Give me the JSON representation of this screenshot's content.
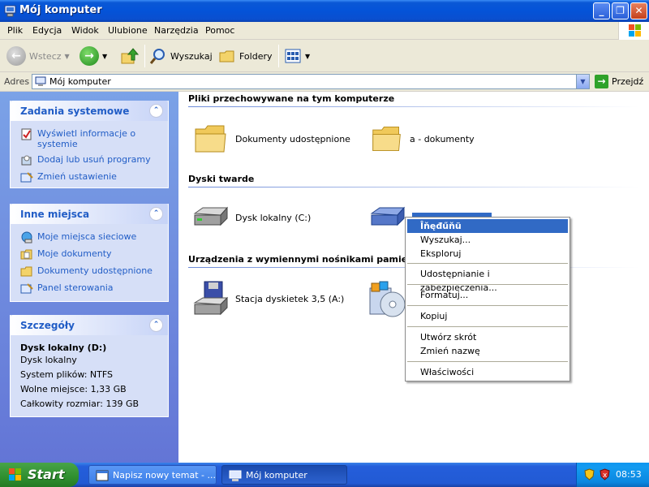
{
  "window": {
    "title": "Mój komputer"
  },
  "menu": [
    "Plik",
    "Edycja",
    "Widok",
    "Ulubione",
    "Narzędzia",
    "Pomoc"
  ],
  "toolbar": {
    "back": "Wstecz",
    "search": "Wyszukaj",
    "folders": "Foldery"
  },
  "address": {
    "label": "Adres",
    "value": "Mój komputer",
    "go": "Przejdź"
  },
  "left": {
    "system_tasks": {
      "title": "Zadania systemowe",
      "links": [
        "Wyświetl informacje o systemie",
        "Dodaj lub usuń programy",
        "Zmień ustawienie"
      ]
    },
    "other_places": {
      "title": "Inne miejsca",
      "links": [
        "Moje miejsca sieciowe",
        "Moje dokumenty",
        "Dokumenty udostępnione",
        "Panel sterowania"
      ]
    },
    "details": {
      "title": "Szczegóły",
      "name": "Dysk lokalny (D:)",
      "type": "Dysk lokalny",
      "fs": "System plików: NTFS",
      "free": "Wolne miejsce: 1,33 GB",
      "total": "Całkowity rozmiar: 139 GB"
    }
  },
  "main": {
    "files_header": "Pliki przechowywane na tym komputerze",
    "files": [
      "Dokumenty udostępnione",
      "a - dokumenty"
    ],
    "hdd_header": "Dyski twarde",
    "hdd": [
      "Dysk lokalny (C:)",
      "Dysk lokalny (D:)"
    ],
    "removable_header": "Urządzenia z wymiennymi nośnikami pamięci",
    "removable": [
      "Stacja dyskietek 3,5 (A:)"
    ]
  },
  "context_menu": [
    "Îňęđűňü",
    "Wyszukaj...",
    "Eksploruj",
    "Udostępnianie i zabezpieczenia...",
    "Formatuj...",
    "Kopiuj",
    "Utwórz skrót",
    "Zmień nazwę",
    "Właściwości"
  ],
  "taskbar": {
    "start": "Start",
    "tasks": [
      "Napisz nowy temat - ...",
      "Mój komputer"
    ],
    "clock": "08:53"
  }
}
